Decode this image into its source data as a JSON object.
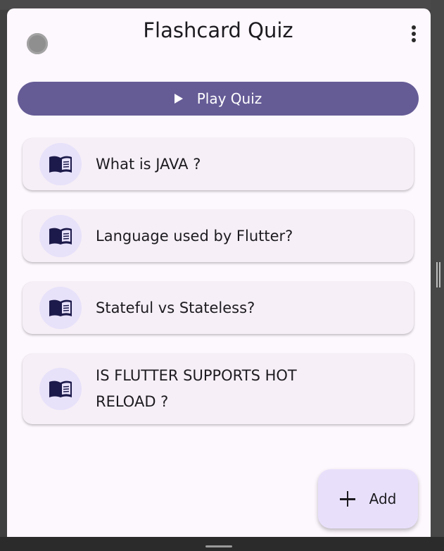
{
  "app_bar": {
    "title": "Flashcard Quiz",
    "avatar_icon": "user-avatar-circle",
    "menu_icon": "more-vertical-icon"
  },
  "play_button": {
    "label": "Play Quiz",
    "icon": "play-icon",
    "color": "#655c96"
  },
  "flashcards": [
    {
      "icon": "book-icon",
      "question": "What is JAVA ?"
    },
    {
      "icon": "book-icon",
      "question": "Language used by Flutter?"
    },
    {
      "icon": "book-icon",
      "question": "Stateful vs Stateless?"
    },
    {
      "icon": "book-icon",
      "question": "IS FLUTTER SUPPORTS HOT RELOAD ?"
    }
  ],
  "fab": {
    "label": "Add",
    "icon": "add-icon"
  },
  "colors": {
    "background": "#fdf7fe",
    "card": "#f6eff7",
    "icon_circle": "#e7e1fa",
    "icon": "#1c1a4a"
  }
}
